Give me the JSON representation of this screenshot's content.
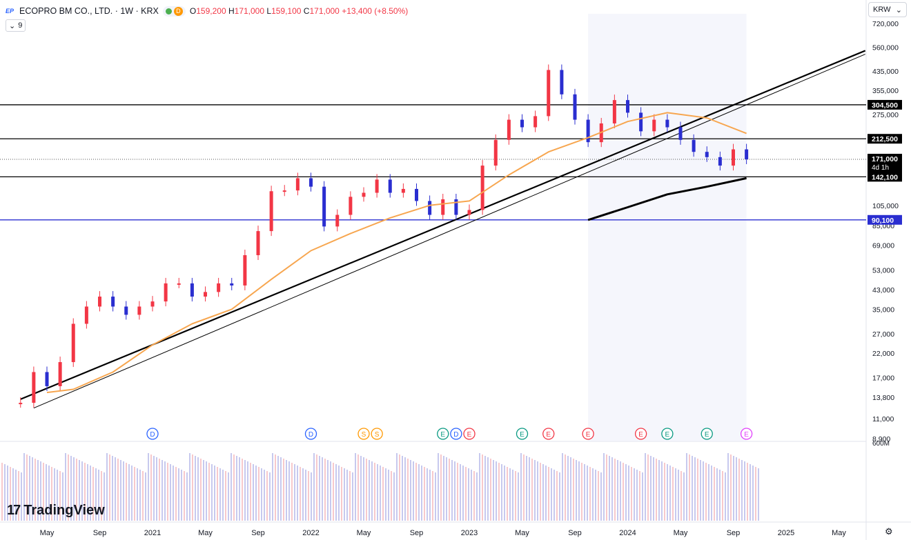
{
  "header": {
    "title": "ECOPRO BM CO., LTD. · 1W · KRX",
    "indicator_badge": "D",
    "ohlc": [
      {
        "label": "O",
        "value": "159,200"
      },
      {
        "label": "H",
        "value": "171,000"
      },
      {
        "label": "L",
        "value": "159,100"
      },
      {
        "label": "C",
        "value": "171,000"
      }
    ],
    "change": "+13,400 (+8.50%)",
    "legend_count": "9"
  },
  "currency": "KRW",
  "branding": "TradingView",
  "chart_data": {
    "type": "line",
    "y_scale": "log",
    "ylim": [
      8900,
      720000
    ],
    "y_ticks": [
      {
        "value": 720000,
        "label": "720,000"
      },
      {
        "value": 560000,
        "label": "560,000"
      },
      {
        "value": 435000,
        "label": "435,000"
      },
      {
        "value": 355000,
        "label": "355,000"
      },
      {
        "value": 275000,
        "label": "275,000"
      },
      {
        "value": 105000,
        "label": "105,000"
      },
      {
        "value": 85000,
        "label": "85,000"
      },
      {
        "value": 69000,
        "label": "69,000"
      },
      {
        "value": 53000,
        "label": "53,000"
      },
      {
        "value": 43000,
        "label": "43,000"
      },
      {
        "value": 35000,
        "label": "35,000"
      },
      {
        "value": 27000,
        "label": "27,000"
      },
      {
        "value": 22000,
        "label": "22,000"
      },
      {
        "value": 17000,
        "label": "17,000"
      },
      {
        "value": 13800,
        "label": "13,800"
      },
      {
        "value": 11000,
        "label": "11,000"
      },
      {
        "value": 8900,
        "label": "8,900"
      }
    ],
    "x_ticks": [
      {
        "date": "2020-05",
        "label": "May"
      },
      {
        "date": "2020-09",
        "label": "Sep"
      },
      {
        "date": "2021-01",
        "label": "2021"
      },
      {
        "date": "2021-05",
        "label": "May"
      },
      {
        "date": "2021-09",
        "label": "Sep"
      },
      {
        "date": "2022-01",
        "label": "2022"
      },
      {
        "date": "2022-05",
        "label": "May"
      },
      {
        "date": "2022-09",
        "label": "Sep"
      },
      {
        "date": "2023-01",
        "label": "2023"
      },
      {
        "date": "2023-05",
        "label": "May"
      },
      {
        "date": "2023-09",
        "label": "Sep"
      },
      {
        "date": "2024-01",
        "label": "2024"
      },
      {
        "date": "2024-05",
        "label": "May"
      },
      {
        "date": "2024-09",
        "label": "Sep"
      },
      {
        "date": "2025-01",
        "label": "2025"
      },
      {
        "date": "2025-05",
        "label": "May"
      }
    ],
    "price_levels": [
      {
        "value": 304500,
        "label": "304,500",
        "color": "#000000"
      },
      {
        "value": 212500,
        "label": "212,500",
        "color": "#000000"
      },
      {
        "value": 142100,
        "label": "142,100",
        "color": "#000000"
      },
      {
        "value": 90100,
        "label": "90,100",
        "color": "#2a2ed0"
      }
    ],
    "current_price": {
      "value": 171000,
      "label": "171,000",
      "countdown": "4d 1h"
    },
    "volume_axis_label": "600M",
    "event_markers": [
      {
        "date": "2021-01",
        "letter": "D",
        "color": "#2962ff"
      },
      {
        "date": "2022-01",
        "letter": "D",
        "color": "#2962ff"
      },
      {
        "date": "2022-05",
        "letter": "S",
        "color": "#ff9800"
      },
      {
        "date": "2022-06",
        "letter": "S",
        "color": "#ff9800"
      },
      {
        "date": "2022-11",
        "letter": "E",
        "color": "#089981"
      },
      {
        "date": "2022-12",
        "letter": "D",
        "color": "#2962ff"
      },
      {
        "date": "2023-01",
        "letter": "E",
        "color": "#f23645"
      },
      {
        "date": "2023-05",
        "letter": "E",
        "color": "#089981"
      },
      {
        "date": "2023-07",
        "letter": "E",
        "color": "#f23645"
      },
      {
        "date": "2023-10",
        "letter": "E",
        "color": "#f23645"
      },
      {
        "date": "2024-02",
        "letter": "E",
        "color": "#f23645"
      },
      {
        "date": "2024-04",
        "letter": "E",
        "color": "#089981"
      },
      {
        "date": "2024-07",
        "letter": "E",
        "color": "#089981"
      },
      {
        "date": "2024-10",
        "letter": "E",
        "color": "#e040fb"
      }
    ],
    "series": [
      {
        "kind": "price",
        "color_up": "#f23645",
        "color_down": "#2a2ed0",
        "points": [
          [
            "2020-03",
            13000
          ],
          [
            "2020-04",
            18000
          ],
          [
            "2020-05",
            15500
          ],
          [
            "2020-06",
            20000
          ],
          [
            "2020-07",
            30000
          ],
          [
            "2020-08",
            36000
          ],
          [
            "2020-09",
            40000
          ],
          [
            "2020-10",
            36000
          ],
          [
            "2020-11",
            33000
          ],
          [
            "2020-12",
            36000
          ],
          [
            "2021-01",
            38000
          ],
          [
            "2021-02",
            46000
          ],
          [
            "2021-03",
            46000
          ],
          [
            "2021-04",
            40000
          ],
          [
            "2021-05",
            42000
          ],
          [
            "2021-06",
            46000
          ],
          [
            "2021-07",
            45000
          ],
          [
            "2021-08",
            62000
          ],
          [
            "2021-09",
            80000
          ],
          [
            "2021-10",
            122000
          ],
          [
            "2021-11",
            123000
          ],
          [
            "2021-12",
            140000
          ],
          [
            "2022-01",
            128000
          ],
          [
            "2022-02",
            84000
          ],
          [
            "2022-03",
            95000
          ],
          [
            "2022-04",
            115000
          ],
          [
            "2022-05",
            120000
          ],
          [
            "2022-06",
            138000
          ],
          [
            "2022-07",
            120000
          ],
          [
            "2022-08",
            125000
          ],
          [
            "2022-09",
            110000
          ],
          [
            "2022-10",
            95000
          ],
          [
            "2022-11",
            112000
          ],
          [
            "2022-12",
            95000
          ],
          [
            "2023-01",
            100000
          ],
          [
            "2023-02",
            160000
          ],
          [
            "2023-03",
            210000
          ],
          [
            "2023-04",
            260000
          ],
          [
            "2023-05",
            240000
          ],
          [
            "2023-06",
            270000
          ],
          [
            "2023-07",
            440000
          ],
          [
            "2023-08",
            340000
          ],
          [
            "2023-09",
            260000
          ],
          [
            "2023-10",
            205000
          ],
          [
            "2023-11",
            250000
          ],
          [
            "2023-12",
            320000
          ],
          [
            "2024-01",
            280000
          ],
          [
            "2024-02",
            230000
          ],
          [
            "2024-03",
            260000
          ],
          [
            "2024-04",
            240000
          ],
          [
            "2024-05",
            210000
          ],
          [
            "2024-06",
            185000
          ],
          [
            "2024-07",
            175000
          ],
          [
            "2024-08",
            160000
          ],
          [
            "2024-09",
            190000
          ],
          [
            "2024-10",
            171000
          ]
        ]
      },
      {
        "kind": "moving-average",
        "color": "#f7a64f",
        "points": [
          [
            "2020-05",
            14500
          ],
          [
            "2020-07",
            15000
          ],
          [
            "2020-10",
            18000
          ],
          [
            "2021-01",
            24000
          ],
          [
            "2021-04",
            30000
          ],
          [
            "2021-07",
            35000
          ],
          [
            "2021-10",
            48000
          ],
          [
            "2022-01",
            65000
          ],
          [
            "2022-04",
            78000
          ],
          [
            "2022-07",
            92000
          ],
          [
            "2022-10",
            105000
          ],
          [
            "2023-01",
            110000
          ],
          [
            "2023-04",
            145000
          ],
          [
            "2023-07",
            185000
          ],
          [
            "2023-10",
            215000
          ],
          [
            "2024-01",
            255000
          ],
          [
            "2024-04",
            280000
          ],
          [
            "2024-07",
            265000
          ],
          [
            "2024-10",
            225000
          ]
        ]
      },
      {
        "kind": "long-average",
        "color": "#000000",
        "points": [
          [
            "2023-10",
            90000
          ],
          [
            "2024-01",
            103000
          ],
          [
            "2024-04",
            118000
          ],
          [
            "2024-07",
            128000
          ],
          [
            "2024-10",
            140000
          ]
        ]
      }
    ],
    "trend_lines": [
      {
        "from": [
          "2020-03",
          13500
        ],
        "to": [
          "2025-07",
          540000
        ],
        "color": "#000000",
        "style": "bold"
      },
      {
        "from": [
          "2020-04",
          12300
        ],
        "to": [
          "2025-07",
          520000
        ],
        "color": "#000000",
        "style": "thin"
      }
    ],
    "projection_zone": {
      "from": "2023-10",
      "to": "2024-10"
    }
  }
}
